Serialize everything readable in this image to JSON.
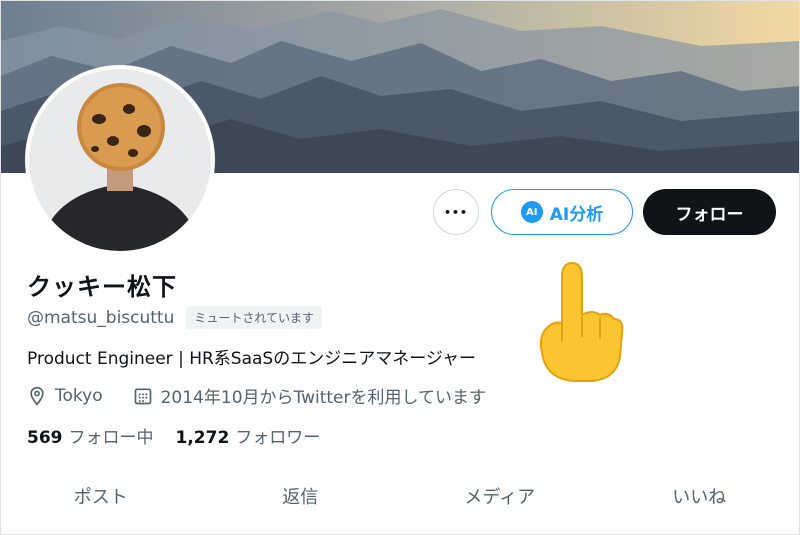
{
  "profile": {
    "name": "クッキー松下",
    "handle": "@matsu_biscuttu",
    "muted_label": "ミュートされています",
    "bio": "Product Engineer | HR系SaaSのエンジニアマネージャー",
    "location": "Tokyo",
    "joined": "2014年10月からTwitterを利用しています"
  },
  "actions": {
    "more_label": "•••",
    "ai_badge": "AI",
    "ai_label": "AI分析",
    "follow_label": "フォロー"
  },
  "stats": {
    "following_count": "569",
    "following_label": "フォロー中",
    "followers_count": "1,272",
    "followers_label": "フォロワー"
  },
  "tabs": [
    {
      "label": "ポスト"
    },
    {
      "label": "返信"
    },
    {
      "label": "メディア"
    },
    {
      "label": "いいね"
    }
  ],
  "icons": {
    "location": "location-pin-icon",
    "calendar": "calendar-icon",
    "pointer": "pointing-up-hand-emoji"
  },
  "colors": {
    "accent": "#1d9bf0",
    "follow_bg": "#0f1419",
    "secondary_text": "#536471"
  }
}
